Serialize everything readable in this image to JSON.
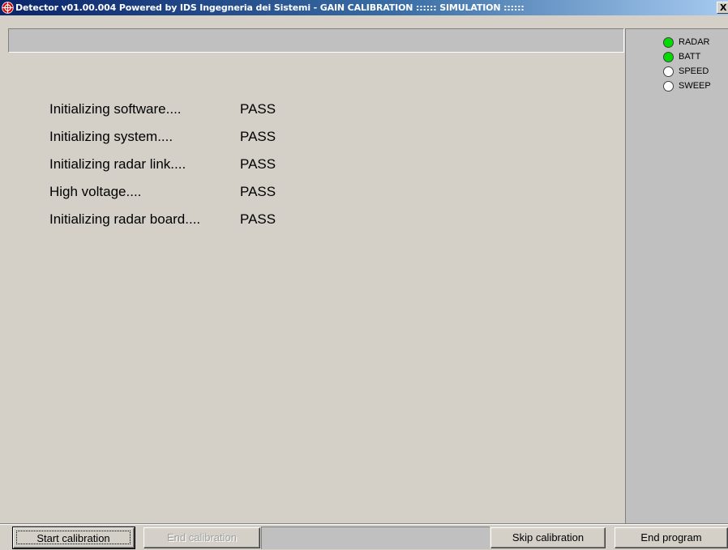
{
  "window": {
    "title": "Detector v01.00.004 Powered by IDS Ingegneria dei Sistemi - GAIN CALIBRATION :::::: SIMULATION ::::::",
    "close_label": "X",
    "app_icon": "crosshair-icon"
  },
  "log": [
    {
      "label": "Initializing software....",
      "status": "PASS"
    },
    {
      "label": "Initializing system....",
      "status": "PASS"
    },
    {
      "label": "Initializing radar link....",
      "status": "PASS"
    },
    {
      "label": "High voltage....",
      "status": "PASS"
    },
    {
      "label": "Initializing radar board....",
      "status": "PASS"
    }
  ],
  "indicators": [
    {
      "label": "RADAR",
      "on": true
    },
    {
      "label": "BATT",
      "on": true
    },
    {
      "label": "SPEED",
      "on": false
    },
    {
      "label": "SWEEP",
      "on": false
    }
  ],
  "colors": {
    "led_on": "#00dc00",
    "led_off": "#ffffff",
    "title_bar": "#0a246a"
  },
  "buttons": {
    "start_calibration": "Start calibration",
    "end_calibration": "End calibration",
    "skip_calibration": "Skip calibration",
    "end_program": "End program"
  }
}
